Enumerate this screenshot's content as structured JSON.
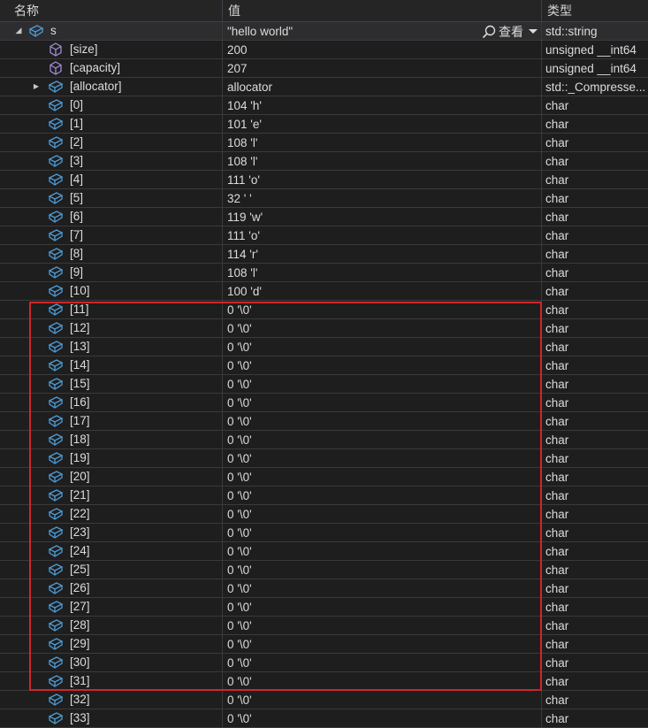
{
  "columns": {
    "name": "名称",
    "value": "值",
    "type": "类型"
  },
  "root": {
    "name": "s",
    "value": "\"hello world\"",
    "viewer_label": "查看",
    "type": "std::string",
    "expanded": true
  },
  "rows": [
    {
      "name": "[size]",
      "value": "200",
      "type": "unsigned __int64",
      "icon": "property-icon",
      "level": 1
    },
    {
      "name": "[capacity]",
      "value": "207",
      "type": "unsigned __int64",
      "icon": "property-icon",
      "level": 1
    },
    {
      "name": "[allocator]",
      "value": "allocator",
      "type": "std::_Compresse...",
      "icon": "field-icon",
      "level": 1,
      "collapsed": true
    },
    {
      "name": "[0]",
      "value": "104 'h'",
      "type": "char",
      "icon": "field-icon",
      "level": 1
    },
    {
      "name": "[1]",
      "value": "101 'e'",
      "type": "char",
      "icon": "field-icon",
      "level": 1
    },
    {
      "name": "[2]",
      "value": "108 'l'",
      "type": "char",
      "icon": "field-icon",
      "level": 1
    },
    {
      "name": "[3]",
      "value": "108 'l'",
      "type": "char",
      "icon": "field-icon",
      "level": 1
    },
    {
      "name": "[4]",
      "value": "111 'o'",
      "type": "char",
      "icon": "field-icon",
      "level": 1
    },
    {
      "name": "[5]",
      "value": "32 ' '",
      "type": "char",
      "icon": "field-icon",
      "level": 1
    },
    {
      "name": "[6]",
      "value": "119 'w'",
      "type": "char",
      "icon": "field-icon",
      "level": 1
    },
    {
      "name": "[7]",
      "value": "111 'o'",
      "type": "char",
      "icon": "field-icon",
      "level": 1
    },
    {
      "name": "[8]",
      "value": "114 'r'",
      "type": "char",
      "icon": "field-icon",
      "level": 1
    },
    {
      "name": "[9]",
      "value": "108 'l'",
      "type": "char",
      "icon": "field-icon",
      "level": 1
    },
    {
      "name": "[10]",
      "value": "100 'd'",
      "type": "char",
      "icon": "field-icon",
      "level": 1
    },
    {
      "name": "[11]",
      "value": "0 '\\0'",
      "type": "char",
      "icon": "field-icon",
      "level": 1
    },
    {
      "name": "[12]",
      "value": "0 '\\0'",
      "type": "char",
      "icon": "field-icon",
      "level": 1
    },
    {
      "name": "[13]",
      "value": "0 '\\0'",
      "type": "char",
      "icon": "field-icon",
      "level": 1
    },
    {
      "name": "[14]",
      "value": "0 '\\0'",
      "type": "char",
      "icon": "field-icon",
      "level": 1
    },
    {
      "name": "[15]",
      "value": "0 '\\0'",
      "type": "char",
      "icon": "field-icon",
      "level": 1
    },
    {
      "name": "[16]",
      "value": "0 '\\0'",
      "type": "char",
      "icon": "field-icon",
      "level": 1
    },
    {
      "name": "[17]",
      "value": "0 '\\0'",
      "type": "char",
      "icon": "field-icon",
      "level": 1
    },
    {
      "name": "[18]",
      "value": "0 '\\0'",
      "type": "char",
      "icon": "field-icon",
      "level": 1
    },
    {
      "name": "[19]",
      "value": "0 '\\0'",
      "type": "char",
      "icon": "field-icon",
      "level": 1
    },
    {
      "name": "[20]",
      "value": "0 '\\0'",
      "type": "char",
      "icon": "field-icon",
      "level": 1
    },
    {
      "name": "[21]",
      "value": "0 '\\0'",
      "type": "char",
      "icon": "field-icon",
      "level": 1
    },
    {
      "name": "[22]",
      "value": "0 '\\0'",
      "type": "char",
      "icon": "field-icon",
      "level": 1
    },
    {
      "name": "[23]",
      "value": "0 '\\0'",
      "type": "char",
      "icon": "field-icon",
      "level": 1
    },
    {
      "name": "[24]",
      "value": "0 '\\0'",
      "type": "char",
      "icon": "field-icon",
      "level": 1
    },
    {
      "name": "[25]",
      "value": "0 '\\0'",
      "type": "char",
      "icon": "field-icon",
      "level": 1
    },
    {
      "name": "[26]",
      "value": "0 '\\0'",
      "type": "char",
      "icon": "field-icon",
      "level": 1
    },
    {
      "name": "[27]",
      "value": "0 '\\0'",
      "type": "char",
      "icon": "field-icon",
      "level": 1
    },
    {
      "name": "[28]",
      "value": "0 '\\0'",
      "type": "char",
      "icon": "field-icon",
      "level": 1
    },
    {
      "name": "[29]",
      "value": "0 '\\0'",
      "type": "char",
      "icon": "field-icon",
      "level": 1
    },
    {
      "name": "[30]",
      "value": "0 '\\0'",
      "type": "char",
      "icon": "field-icon",
      "level": 1
    },
    {
      "name": "[31]",
      "value": "0 '\\0'",
      "type": "char",
      "icon": "field-icon",
      "level": 1
    },
    {
      "name": "[32]",
      "value": "0 '\\0'",
      "type": "char",
      "icon": "field-icon",
      "level": 1
    },
    {
      "name": "[33]",
      "value": "0 '\\0'",
      "type": "char",
      "icon": "field-icon",
      "level": 1
    }
  ],
  "colors": {
    "background": "#1e1e1e",
    "text": "#dcdcdc",
    "field_icon": "#4e9cd6",
    "property_icon": "#a08ad6",
    "highlight_border": "#d0262b"
  }
}
